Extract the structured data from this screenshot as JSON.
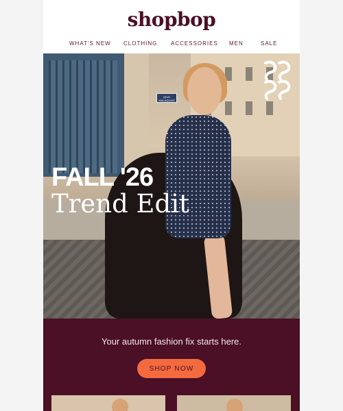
{
  "brand": {
    "logo_text": "shopbop"
  },
  "nav": {
    "items": [
      {
        "label": "WHAT'S NEW"
      },
      {
        "label": "CLOTHING"
      },
      {
        "label": "ACCESSORIES"
      },
      {
        "label": "MEN"
      },
      {
        "label": "SALE"
      }
    ]
  },
  "hero": {
    "title_line1": "FALL '26",
    "title_line2": "Trend Edit",
    "street_sign": "QUAI MALAQUAIS"
  },
  "promo": {
    "tagline": "Your autumn fashion fix starts here.",
    "cta_label": "SHOP NOW"
  },
  "colors": {
    "brand_burgundy": "#4b0f26",
    "cta_orange": "#f36a3f",
    "page_background": "#f4f4f4"
  }
}
